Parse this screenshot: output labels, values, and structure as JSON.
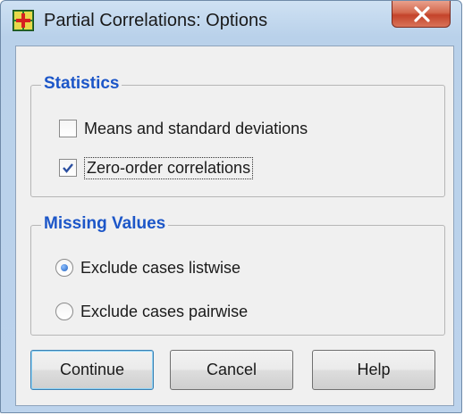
{
  "window": {
    "title": "Partial Correlations: Options",
    "close_icon": "close-x-icon",
    "app_icon": "spss-dialog-icon"
  },
  "statistics": {
    "title": "Statistics",
    "options": [
      {
        "label": "Means and standard deviations",
        "checked": false
      },
      {
        "label": "Zero-order correlations",
        "checked": true
      }
    ]
  },
  "missing_values": {
    "title": "Missing Values",
    "options": [
      {
        "label": "Exclude cases listwise",
        "selected": true
      },
      {
        "label": "Exclude cases pairwise",
        "selected": false
      }
    ]
  },
  "buttons": {
    "continue": "Continue",
    "cancel": "Cancel",
    "help": "Help"
  },
  "colors": {
    "group_title": "#1c56c8",
    "close_button": "#c4432a"
  }
}
